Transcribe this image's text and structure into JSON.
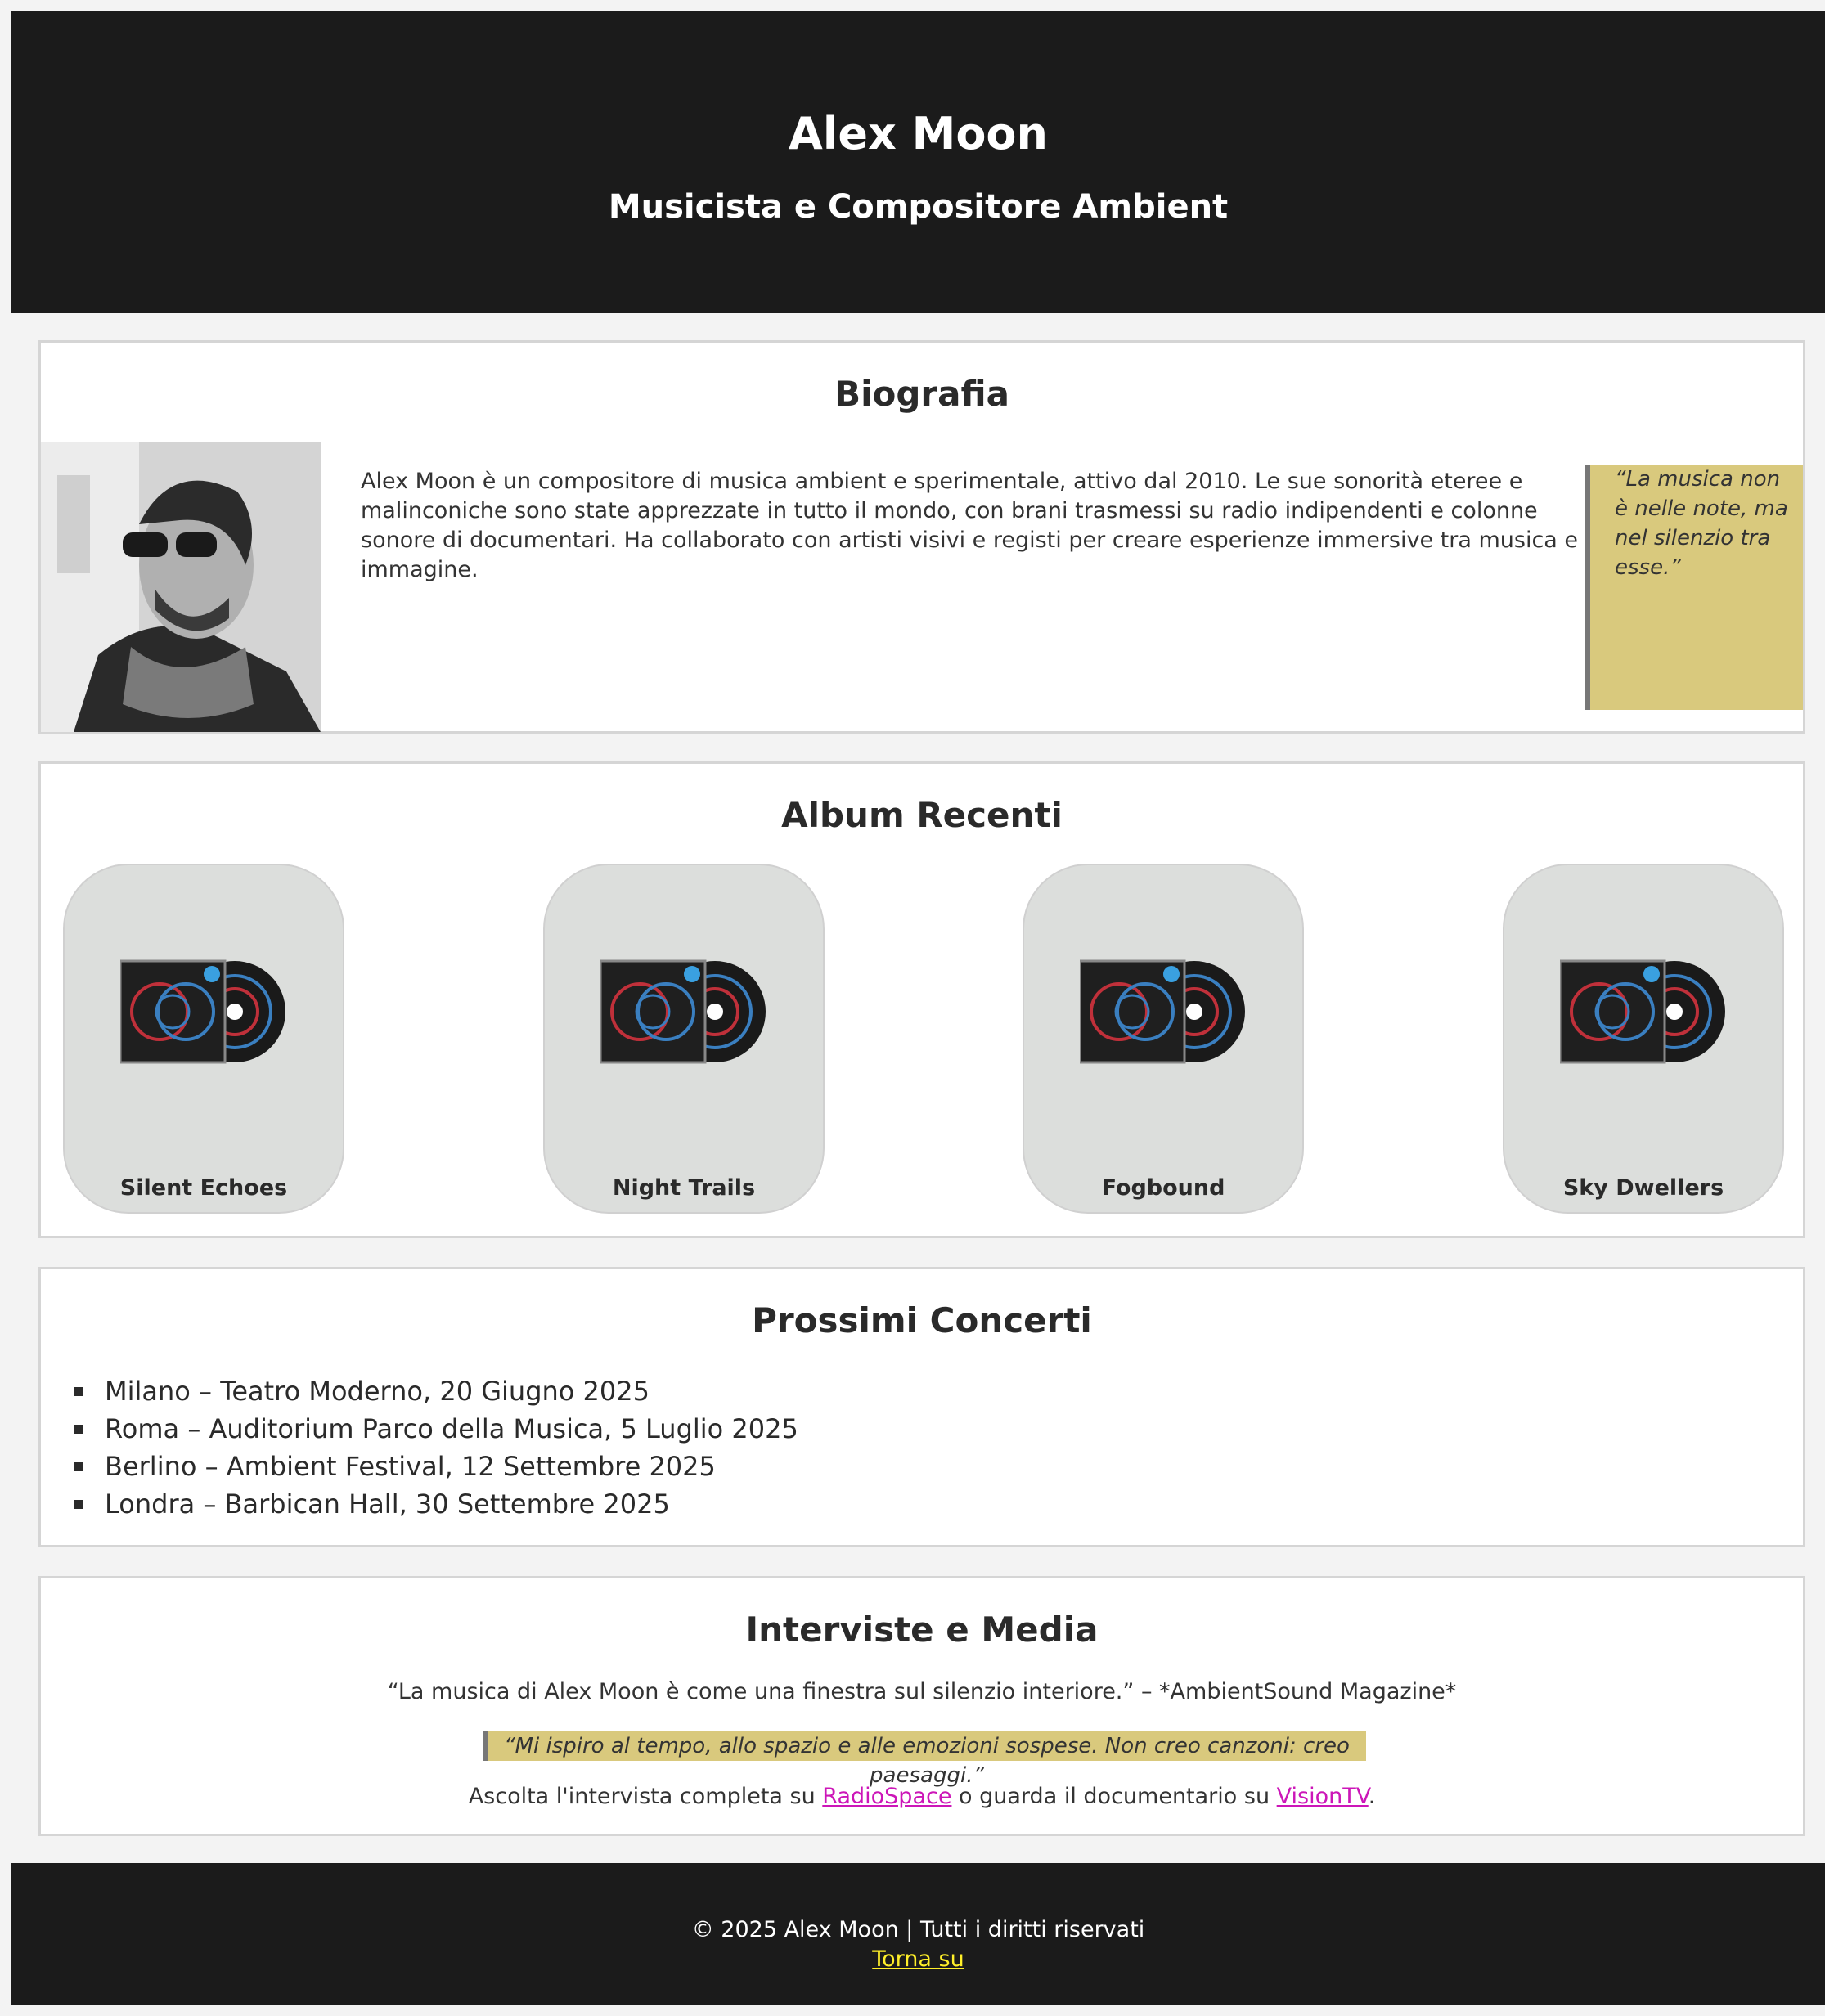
{
  "header": {
    "name": "Alex Moon",
    "subtitle": "Musicista e Compositore Ambient"
  },
  "bio": {
    "title": "Biografia",
    "text": "Alex Moon è un compositore di musica ambient e sperimentale, attivo dal 2010. Le sue sonorità eteree e malinconiche sono state apprezzate in tutto il mondo, con brani trasmessi su radio indipendenti e colonne sonore di documentari. Ha collaborato con artisti visivi e registi per creare esperienze immersive tra musica e immagine.",
    "quote": "“La musica non è nelle note, ma nel silenzio tra esse.”"
  },
  "albums": {
    "title": "Album Recenti",
    "items": [
      {
        "title": "Silent Echoes"
      },
      {
        "title": "Night Trails"
      },
      {
        "title": "Fogbound"
      },
      {
        "title": "Sky Dwellers"
      }
    ]
  },
  "concerts": {
    "title": "Prossimi Concerti",
    "items": [
      "Milano – Teatro Moderno, 20 Giugno 2025",
      "Roma – Auditorium Parco della Musica, 5 Luglio 2025",
      "Berlino – Ambient Festival, 12 Settembre 2025",
      "Londra – Barbican Hall, 30 Settembre 2025"
    ]
  },
  "media": {
    "title": "Interviste e Media",
    "press_quote": "“La musica di Alex Moon è come una finestra sul silenzio interiore.” – *AmbientSound Magazine*",
    "artist_quote": "“Mi ispiro al tempo, allo spazio e alle emozioni sospese. Non creo canzoni: creo paesaggi.”",
    "listen_prefix": "Ascolta l'intervista completa su ",
    "link1": "RadioSpace",
    "listen_middle": " o guarda il documentario su ",
    "link2": "VisionTV",
    "listen_suffix": "."
  },
  "footer": {
    "copyright": "© 2025 Alex Moon | Tutti i diritti riservati",
    "back_to_top": "Torna su"
  },
  "colors": {
    "dark": "#1b1b1b",
    "quote_bg": "#d9c97d",
    "link": "#cc16b8",
    "footer_link": "#ffef29"
  }
}
